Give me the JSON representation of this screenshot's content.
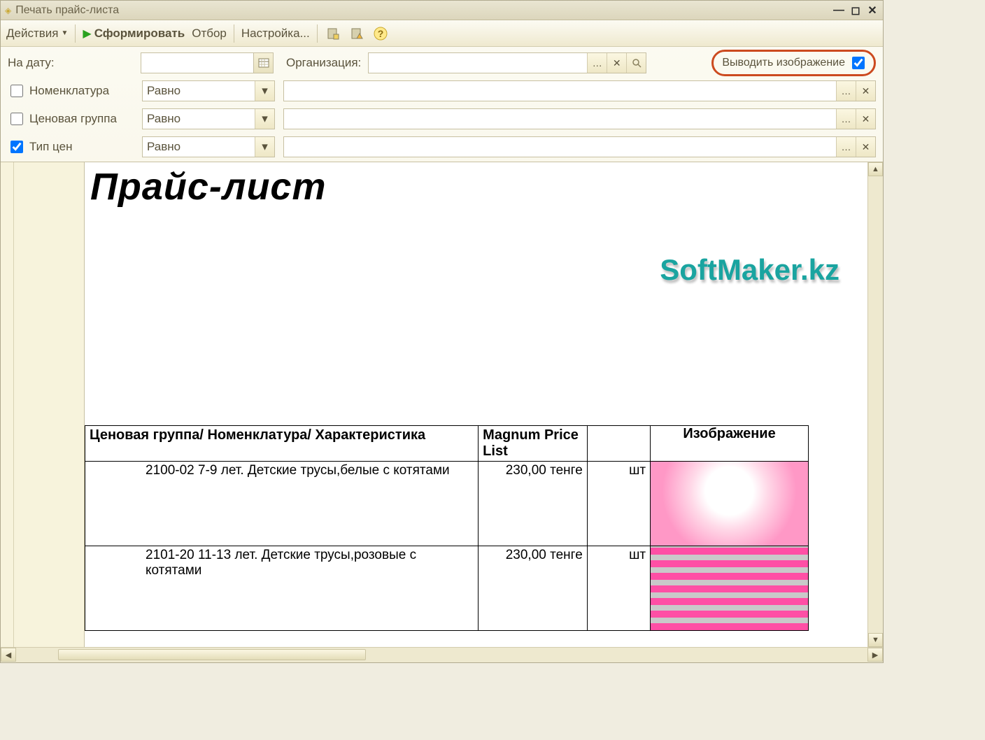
{
  "window": {
    "title": "Печать прайс-листа"
  },
  "toolbar": {
    "actions": "Действия",
    "generate": "Сформировать",
    "filter": "Отбор",
    "settings": "Настройка..."
  },
  "filters": {
    "date_label": "На дату:",
    "org_label": "Организация:",
    "output_image_label": "Выводить изображение",
    "output_image_checked": true,
    "rows": [
      {
        "label": "Номенклатура",
        "checked": false,
        "op": "Равно"
      },
      {
        "label": "Ценовая группа",
        "checked": false,
        "op": "Равно"
      },
      {
        "label": "Тип цен",
        "checked": true,
        "op": "Равно"
      }
    ]
  },
  "report": {
    "title": "Прайс-лист",
    "watermark": "SoftMaker.kz",
    "columns": {
      "item": "Ценовая группа/ Номенклатура/ Характеристика",
      "price": "Magnum Price List",
      "image": "Изображение"
    },
    "rows": [
      {
        "name": "2100-02 7-9 лет. Детские трусы,белые с котятами",
        "price": "230,00 тенге",
        "unit": "шт"
      },
      {
        "name": "2101-20 11-13 лет. Детские трусы,розовые с котятами",
        "price": "230,00 тенге",
        "unit": "шт"
      }
    ]
  }
}
